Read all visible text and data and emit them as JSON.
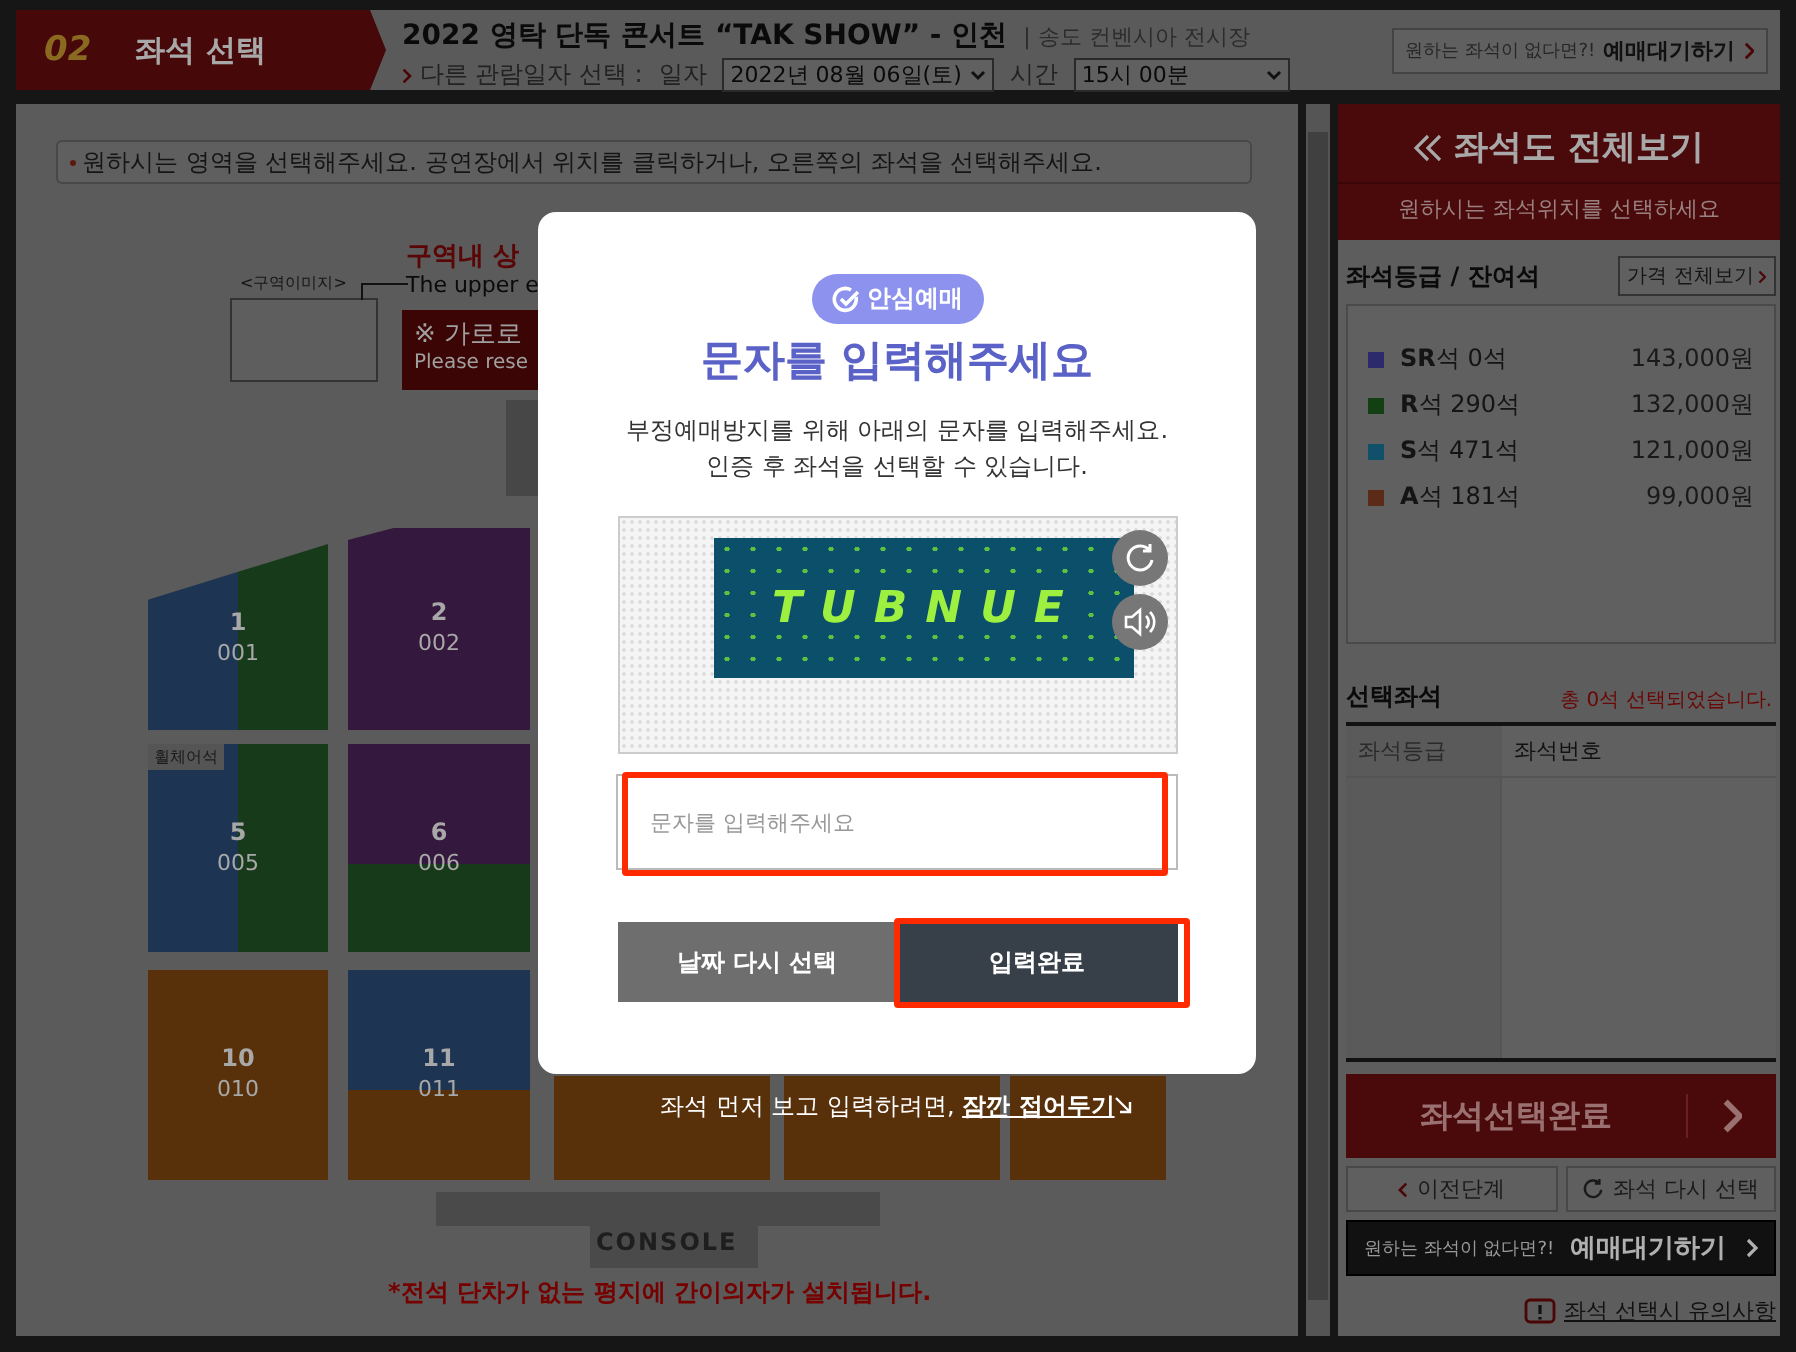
{
  "header": {
    "step_number": "02",
    "step_label": "좌석 선택",
    "title": "2022 영탁 단독 콘서트 “TAK SHOW” - 인천",
    "venue": "| 송도 컨벤시아 전시장",
    "date_prompt": "다른 관람일자 선택 :",
    "date_label": "일자",
    "date_value": "2022년 08월 06일(토)",
    "time_label": "시간",
    "time_value": "15시 00분",
    "waitlist_hint": "원하는 좌석이 없다면?!",
    "waitlist_label": "예매대기하기"
  },
  "notice": "원하시는 영역을 선택해주세요. 공연장에서 위치를 클릭하거나, 오른쪽의 좌석을 선택해주세요.",
  "seat_map": {
    "legend_caption": "<구역이미지>",
    "upper_title": "구역내 상",
    "upper_subtitle": "The upper e",
    "warning_title": "※ 가로로",
    "warning_subtitle": "Please rese",
    "wheelchair_label": "휠체어석",
    "console": "CONSOLE",
    "footnote": "*전석 단차가 없는 평지에 간이의자가 설치됩니다.",
    "sections": [
      {
        "number": "1",
        "code": "001",
        "kind": "columns",
        "zones": [
          {
            "color": "#1d3452"
          },
          {
            "color": "#173a1a"
          }
        ]
      },
      {
        "number": "2",
        "code": "002",
        "kind": "single",
        "zones": [
          {
            "color": "#35183d"
          }
        ]
      },
      {
        "number": "5",
        "code": "005",
        "kind": "columns",
        "wheelchair": true,
        "zones": [
          {
            "color": "#1d3452"
          },
          {
            "color": "#173a1a"
          }
        ]
      },
      {
        "number": "6",
        "code": "006",
        "kind": "rows",
        "zones": [
          {
            "color": "#35183d"
          },
          {
            "color": "#173a1a"
          }
        ]
      },
      {
        "number": "10",
        "code": "010",
        "kind": "single",
        "zones": [
          {
            "color": "#58300a"
          }
        ]
      },
      {
        "number": "11",
        "code": "011",
        "kind": "rows",
        "zones": [
          {
            "color": "#1d3452"
          },
          {
            "color": "#58300a"
          }
        ]
      },
      {
        "kind": "single",
        "zones": [
          {
            "color": "#58300a"
          }
        ]
      },
      {
        "kind": "single",
        "zones": [
          {
            "color": "#58300a"
          }
        ]
      },
      {
        "kind": "single",
        "zones": [
          {
            "color": "#58300a"
          }
        ]
      }
    ]
  },
  "sidebar": {
    "overview_title": "좌석도 전체보기",
    "overview_subtitle": "원하시는 좌석위치를 선택하세요",
    "grades_title": "좌석등급 / 잔여석",
    "price_button": "가격 전체보기",
    "grades": [
      {
        "label": "**SR**석 0석",
        "price": "143,000원",
        "color": "#2c2a6a"
      },
      {
        "label": "**R**석 290석",
        "price": "132,000원",
        "color": "#124012"
      },
      {
        "label": "**S**석 471석",
        "price": "121,000원",
        "color": "#11506a"
      },
      {
        "label": "**A**석 181석",
        "price": "99,000원",
        "color": "#5c2b18"
      }
    ],
    "selected_title": "선택좌석",
    "selected_summary": "총 0석 선택되었습니다.",
    "columns": [
      "좌석등급",
      "좌석번호"
    ],
    "complete_button": "좌석선택완료",
    "prev_button": "이전단계",
    "reset_button": "좌석 다시 선택",
    "waitlist_hint": "원하는 좌석이 없다면?!",
    "waitlist_label": "예매대기하기",
    "caution_link": "좌석 선택시 유의사항"
  },
  "dialog": {
    "badge": "안심예매",
    "title": "문자를 입력해주세요",
    "description": [
      "부정예매방지를 위해 아래의 문자를 입력해주세요.",
      "인증 후 좌석을 선택할 수 있습니다."
    ],
    "captcha_text": "TUBNUE",
    "placeholder": "문자를 입력해주세요",
    "buttons": [
      {
        "label": "날짜 다시 선택",
        "kind": "secondary",
        "highlighted": false
      },
      {
        "label": "입력완료",
        "kind": "primary",
        "highlighted": true
      }
    ],
    "input_highlighted": true,
    "fold_prompt": "좌석 먼저 보고 입력하려면, ",
    "fold_link": "잠깐 접어두기"
  }
}
